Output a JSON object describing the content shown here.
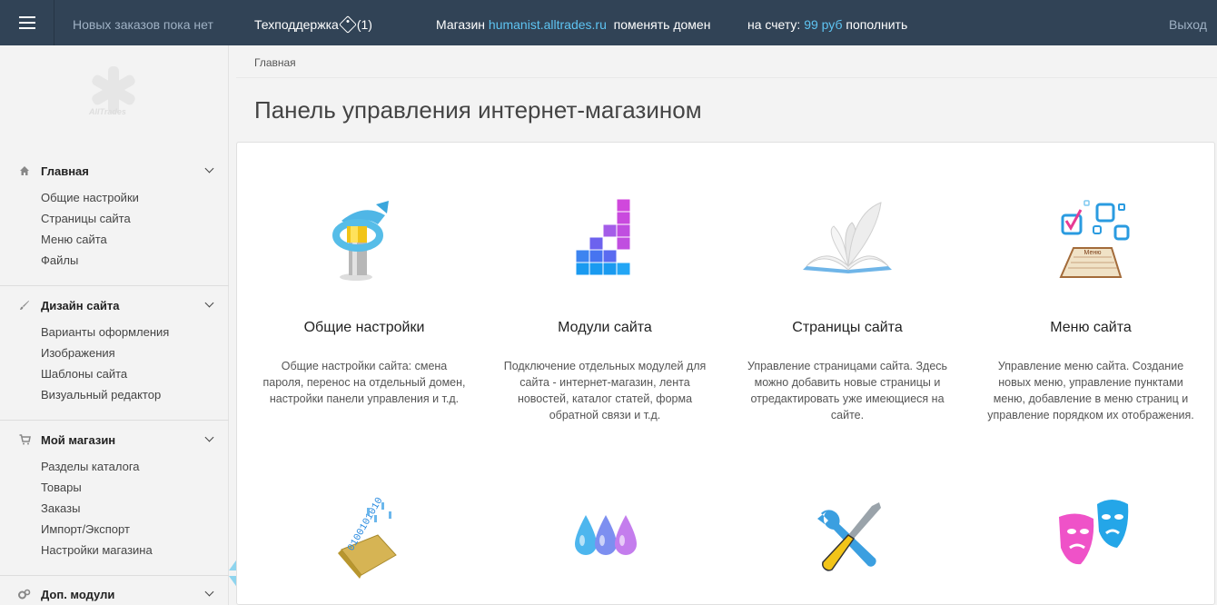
{
  "topbar": {
    "orders": "Новых заказов пока нет",
    "support": "Техподдержка",
    "support_count": "(1)",
    "shop_label": "Магазин",
    "shop_domain": "humanist.alltrades.ru",
    "change_domain": "поменять домен",
    "balance_label": "на счету:",
    "balance_value": "99 руб",
    "topup": "пополнить",
    "logout": "Выход"
  },
  "logo": {
    "text": "AllTrades"
  },
  "sidebar": {
    "sections": [
      {
        "title": "Главная",
        "icon": "home-icon",
        "items": [
          "Общие настройки",
          "Страницы сайта",
          "Меню сайта",
          "Файлы"
        ]
      },
      {
        "title": "Дизайн сайта",
        "icon": "brush-icon",
        "items": [
          "Варианты оформления",
          "Изображения",
          "Шаблоны сайта",
          "Визуальный редактор"
        ]
      },
      {
        "title": "Мой магазин",
        "icon": "cart-icon",
        "items": [
          "Разделы каталога",
          "Товары",
          "Заказы",
          "Импорт/Экспорт",
          "Настройки магазина"
        ]
      },
      {
        "title": "Доп. модули",
        "icon": "gears-icon",
        "items": []
      }
    ]
  },
  "breadcrumb": "Главная",
  "page_title": "Панель управления интернет-магазином",
  "cards": [
    {
      "title": "Общие настройки",
      "desc": "Общие настройки сайта: смена пароля, перенос на отдельный домен, настройки панели управления и т.д.",
      "icon": "wrench-bolt-icon"
    },
    {
      "title": "Модули сайта",
      "desc": "Подключение отдельных модулей для сайта - интернет-магазин, лента новостей, каталог статей, форма обратной связи и т.д.",
      "icon": "blocks-icon"
    },
    {
      "title": "Страницы сайта",
      "desc": "Управление страницами сайта. Здесь можно добавить новые страницы и отредактировать уже имеющиеся на сайте.",
      "icon": "book-icon"
    },
    {
      "title": "Меню сайта",
      "desc": "Управление меню сайта. Создание новых меню, управление пунктами меню, добавление в меню страниц и управление порядком их отображения.",
      "icon": "menu-checklist-icon",
      "icon_caption": "Меню"
    },
    {
      "icon": "binary-folder-icon",
      "icon_caption": "0100101010"
    },
    {
      "icon": "drops-icon"
    },
    {
      "icon": "tools-icon"
    },
    {
      "icon": "masks-icon"
    }
  ]
}
